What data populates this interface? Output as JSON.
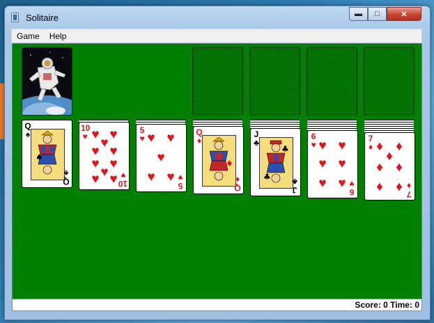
{
  "window": {
    "title": "Solitaire"
  },
  "menu": {
    "items": [
      "Game",
      "Help"
    ]
  },
  "status": {
    "score_label": "Score:",
    "score": "0",
    "time_label": "Time:",
    "time": "0"
  },
  "deck_back": {
    "design": "astronaut-spacewalk"
  },
  "foundations": [
    "empty",
    "empty",
    "empty",
    "empty"
  ],
  "tableau": [
    {
      "face_down": 0,
      "top": {
        "rank": "Q",
        "suit": "♠",
        "color": "black"
      }
    },
    {
      "face_down": 1,
      "top": {
        "rank": "10",
        "suit": "♥",
        "color": "red"
      }
    },
    {
      "face_down": 2,
      "top": {
        "rank": "5",
        "suit": "♥",
        "color": "red"
      }
    },
    {
      "face_down": 3,
      "top": {
        "rank": "Q",
        "suit": "♦",
        "color": "red"
      }
    },
    {
      "face_down": 4,
      "top": {
        "rank": "J",
        "suit": "♣",
        "color": "black"
      }
    },
    {
      "face_down": 5,
      "top": {
        "rank": "6",
        "suit": "♥",
        "color": "red"
      }
    },
    {
      "face_down": 6,
      "top": {
        "rank": "7",
        "suit": "♦",
        "color": "red"
      }
    }
  ],
  "colors": {
    "felt": "#007f00",
    "red_suit": "#e0141b",
    "black_suit": "#000000"
  }
}
